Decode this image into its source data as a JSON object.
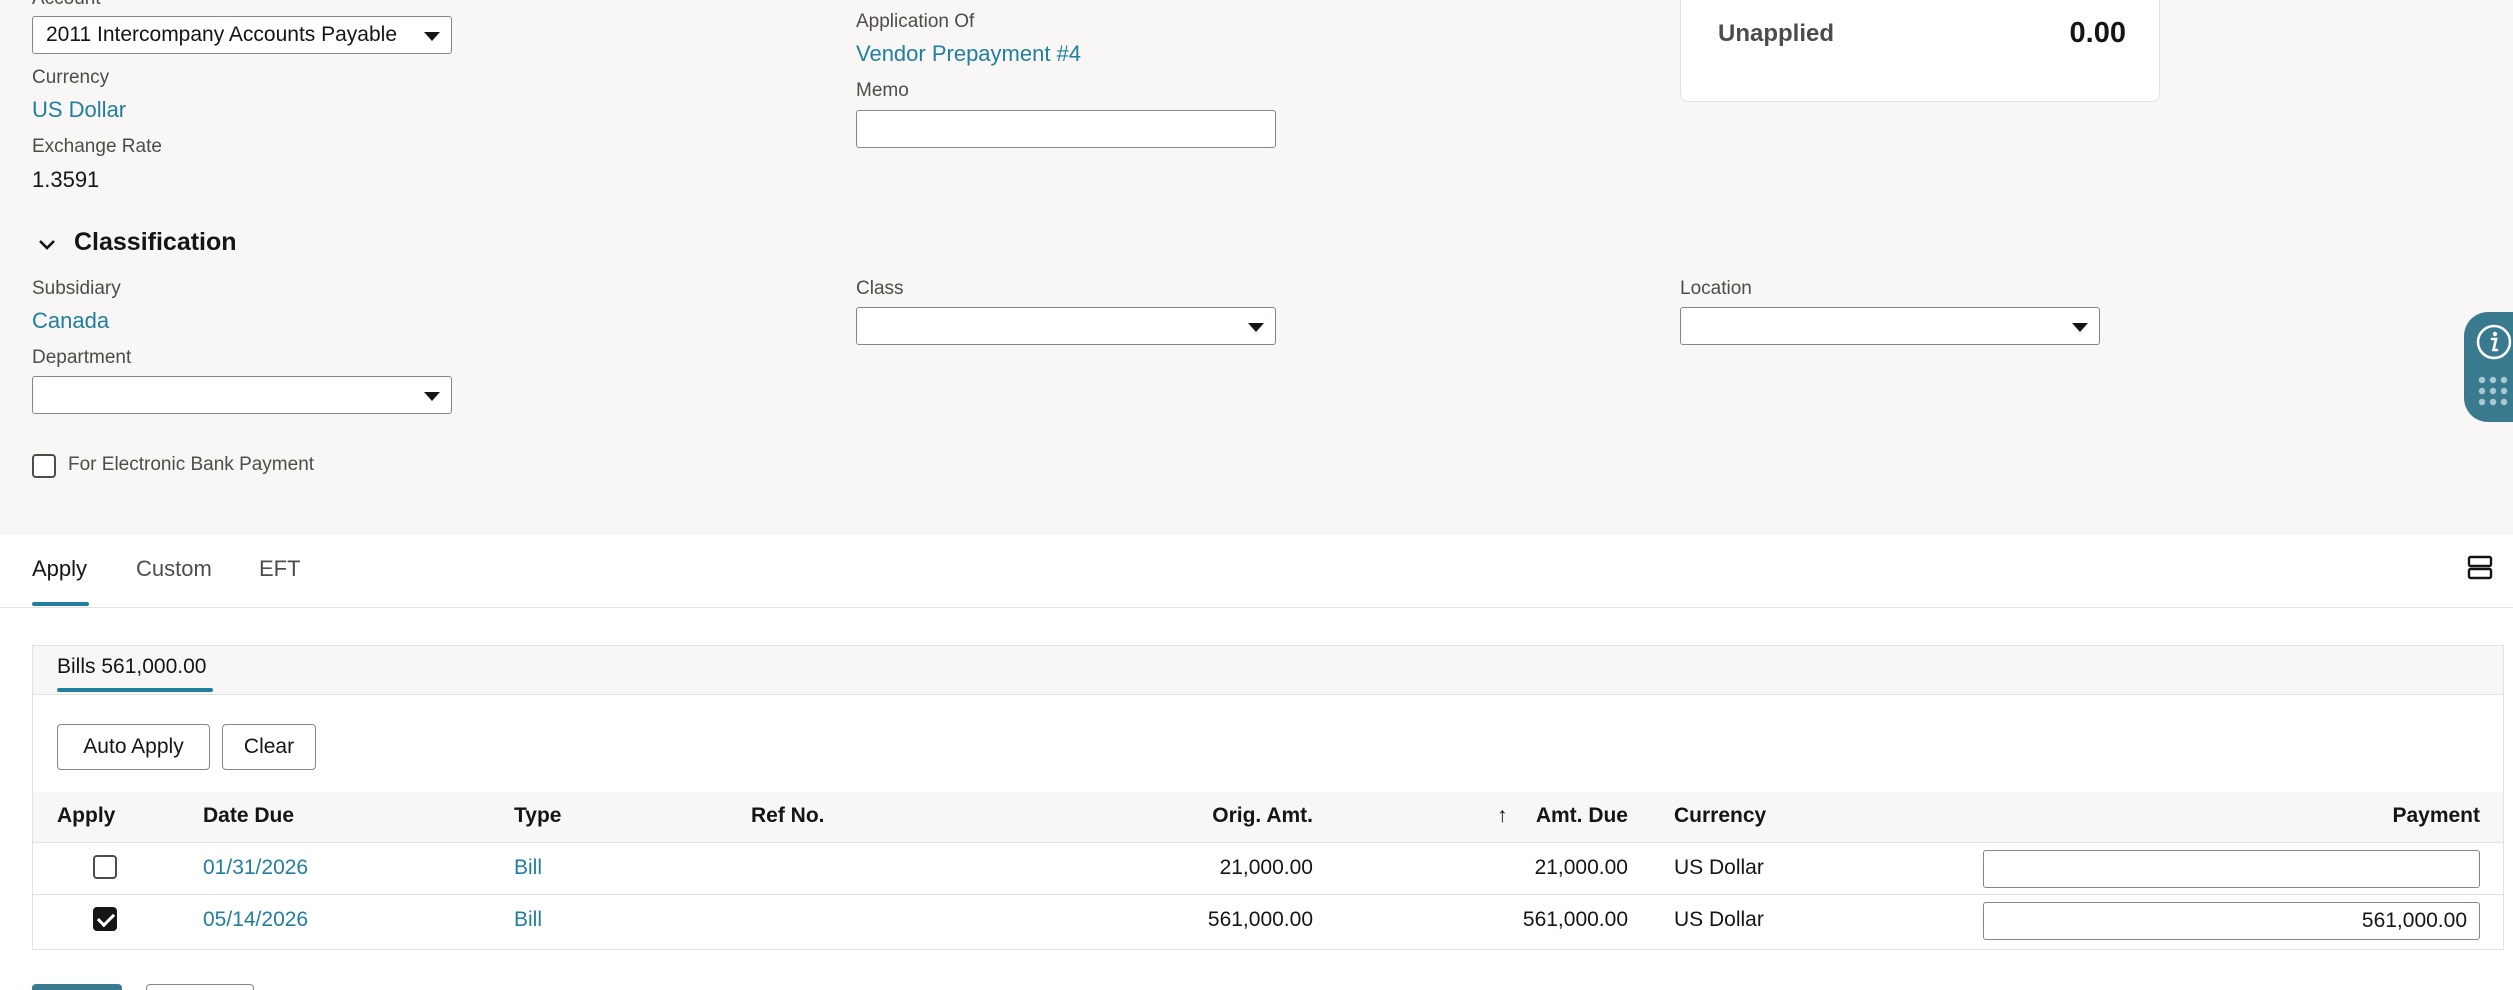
{
  "primary": {
    "account_label": "Account",
    "account_value": "2011 Intercompany Accounts Payable",
    "currency_label": "Currency",
    "currency_value": "US Dollar",
    "exchange_rate_label": "Exchange Rate",
    "exchange_rate_value": "1.3591",
    "application_of_label": "Application Of",
    "application_of_value": "Vendor Prepayment #4",
    "memo_label": "Memo",
    "memo_value": ""
  },
  "summary": {
    "unapplied_label": "Unapplied",
    "unapplied_value": "0.00"
  },
  "classification": {
    "title": "Classification",
    "subsidiary_label": "Subsidiary",
    "subsidiary_value": "Canada",
    "class_label": "Class",
    "class_value": "",
    "location_label": "Location",
    "location_value": "",
    "department_label": "Department",
    "department_value": "",
    "electronic_payment_label": "For Electronic Bank Payment",
    "electronic_payment_checked": false
  },
  "tabs": [
    {
      "label": "Apply",
      "active": true
    },
    {
      "label": "Custom",
      "active": false
    },
    {
      "label": "EFT",
      "active": false
    }
  ],
  "apply": {
    "subtab_label": "Bills 561,000.00",
    "auto_apply_label": "Auto Apply",
    "clear_label": "Clear",
    "columns": {
      "apply": "Apply",
      "date_due": "Date Due",
      "type": "Type",
      "ref_no": "Ref No.",
      "orig_amt": "Orig. Amt.",
      "sort_arrow": "↑",
      "amt_due": "Amt. Due",
      "currency": "Currency",
      "payment": "Payment"
    },
    "rows": [
      {
        "apply": false,
        "date_due": "01/31/2026",
        "type": "Bill",
        "ref_no": "",
        "orig_amt": "21,000.00",
        "amt_due": "21,000.00",
        "currency": "US Dollar",
        "payment": ""
      },
      {
        "apply": true,
        "date_due": "05/14/2026",
        "type": "Bill",
        "ref_no": "",
        "orig_amt": "561,000.00",
        "amt_due": "561,000.00",
        "currency": "US Dollar",
        "payment": "561,000.00"
      }
    ]
  },
  "colors": {
    "link": "#227e9e",
    "accent_underline": "#227e9e",
    "side_widget": "#3a7a8f"
  },
  "icons": [
    "chevron-down-icon",
    "info-icon",
    "apps-grid-icon",
    "view-toggle-icon",
    "dropdown-caret-icon"
  ]
}
